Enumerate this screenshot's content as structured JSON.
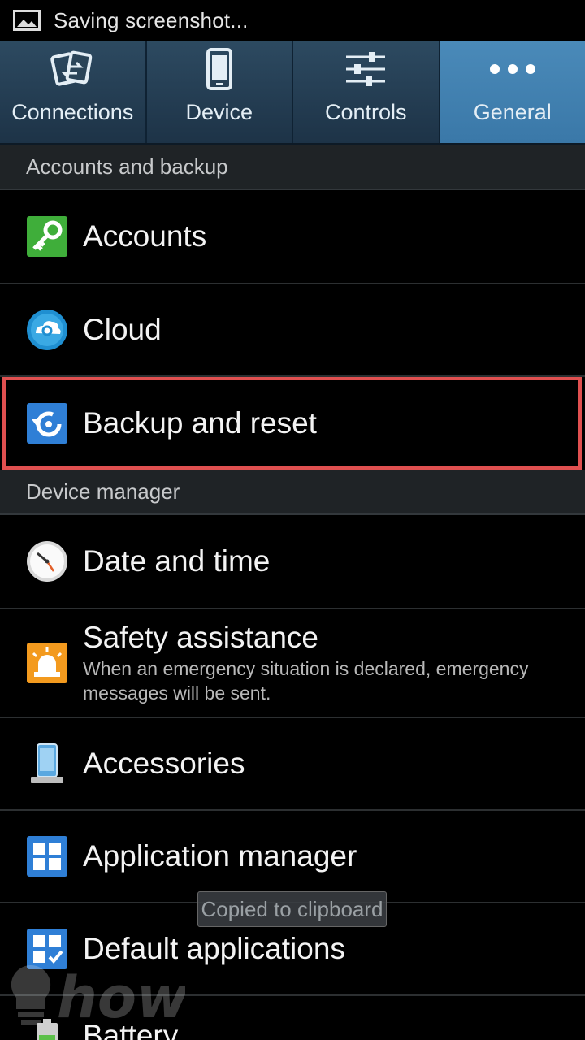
{
  "status_bar": {
    "text": "Saving screenshot...",
    "icon": "image-icon"
  },
  "tabs": [
    {
      "label": "Connections",
      "icon": "connections-icon",
      "active": false
    },
    {
      "label": "Device",
      "icon": "device-icon",
      "active": false
    },
    {
      "label": "Controls",
      "icon": "controls-icon",
      "active": false
    },
    {
      "label": "General",
      "icon": "more-icon",
      "active": true
    }
  ],
  "sections": [
    {
      "header": "Accounts and backup",
      "items": [
        {
          "title": "Accounts",
          "icon": "key-icon"
        },
        {
          "title": "Cloud",
          "icon": "cloud-icon"
        },
        {
          "title": "Backup and reset",
          "icon": "backup-reset-icon",
          "highlighted": true
        }
      ]
    },
    {
      "header": "Device manager",
      "items": [
        {
          "title": "Date and time",
          "icon": "clock-icon"
        },
        {
          "title": "Safety assistance",
          "subtitle": "When an emergency situation is declared, emergency messages will be sent.",
          "icon": "siren-icon"
        },
        {
          "title": "Accessories",
          "icon": "accessories-icon"
        },
        {
          "title": "Application manager",
          "icon": "app-grid-icon"
        },
        {
          "title": "Default applications",
          "icon": "default-apps-icon"
        },
        {
          "title": "Battery",
          "icon": "battery-icon"
        }
      ]
    }
  ],
  "toast": "Copied to clipboard",
  "colors": {
    "highlight": "#e05050",
    "active_tab": "#3a78a8",
    "tab_bar": "#1d3347"
  }
}
